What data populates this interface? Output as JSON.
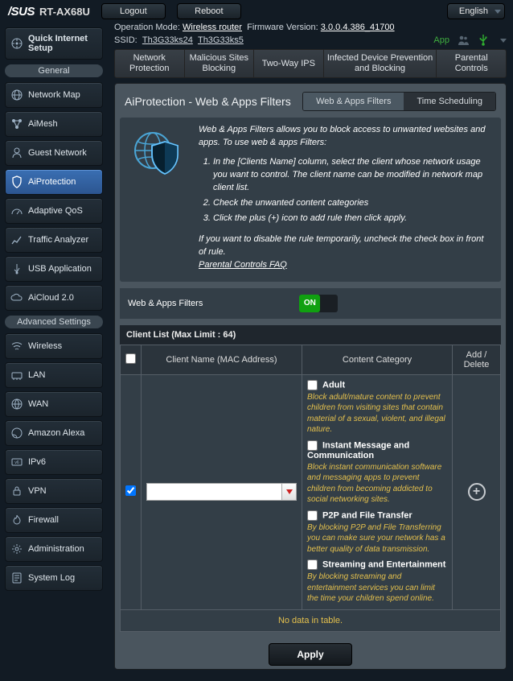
{
  "brand": {
    "logo": "/SUS",
    "model": "RT-AX68U"
  },
  "topbar": {
    "logout": "Logout",
    "reboot": "Reboot",
    "language": "English"
  },
  "info": {
    "op_label": "Operation Mode:",
    "op_value": "Wireless router",
    "fw_label": "Firmware Version:",
    "fw_value": "3.0.0.4.386_41700",
    "ssid_label": "SSID:",
    "ssid1": "Th3G33ks24",
    "ssid2": "Th3G33ks5",
    "app": "App"
  },
  "sidebar": {
    "qis": "Quick Internet Setup",
    "sec_general": "General",
    "items_general": [
      "Network Map",
      "AiMesh",
      "Guest Network",
      "AiProtection",
      "Adaptive QoS",
      "Traffic Analyzer",
      "USB Application",
      "AiCloud 2.0"
    ],
    "sec_adv": "Advanced Settings",
    "items_adv": [
      "Wireless",
      "LAN",
      "WAN",
      "Amazon Alexa",
      "IPv6",
      "VPN",
      "Firewall",
      "Administration",
      "System Log"
    ]
  },
  "tabs": [
    "Network Protection",
    "Malicious Sites Blocking",
    "Two-Way IPS",
    "Infected Device Prevention and Blocking",
    "Parental Controls"
  ],
  "panel_title": "AiProtection - Web & Apps Filters",
  "subtabs": {
    "a": "Web & Apps Filters",
    "b": "Time Scheduling"
  },
  "intro": {
    "lead": "Web & Apps Filters allows you to block access to unwanted websites and apps. To use web & apps Filters:",
    "steps": [
      "In the [Clients Name] column, select the client whose network usage you want to control. The client name can be modified in network map client list.",
      "Check the unwanted content categories",
      "Click the plus (+) icon to add rule then click apply."
    ],
    "note": "If you want to disable the rule temporarily, uncheck the check box in front of rule.",
    "faq": "Parental Controls FAQ"
  },
  "toggle": {
    "label": "Web & Apps Filters",
    "state": "ON"
  },
  "clientlist": {
    "header": "Client List (Max Limit : 64)",
    "cols": {
      "name": "Client Name (MAC Address)",
      "cat": "Content Category",
      "add": "Add / Delete"
    },
    "nodata": "No data in table."
  },
  "categories": [
    {
      "title": "Adult",
      "desc": "Block adult/mature content to prevent children from visiting sites that contain material of a sexual, violent, and illegal nature."
    },
    {
      "title": "Instant Message and Communication",
      "desc": "Block instant communication software and messaging apps to prevent children from becoming addicted to social networking sites."
    },
    {
      "title": "P2P and File Transfer",
      "desc": "By blocking P2P and File Transferring you can make sure your network has a better quality of data transmission."
    },
    {
      "title": "Streaming and Entertainment",
      "desc": "By blocking streaming and entertainment services you can limit the time your children spend online."
    }
  ],
  "apply": "Apply"
}
